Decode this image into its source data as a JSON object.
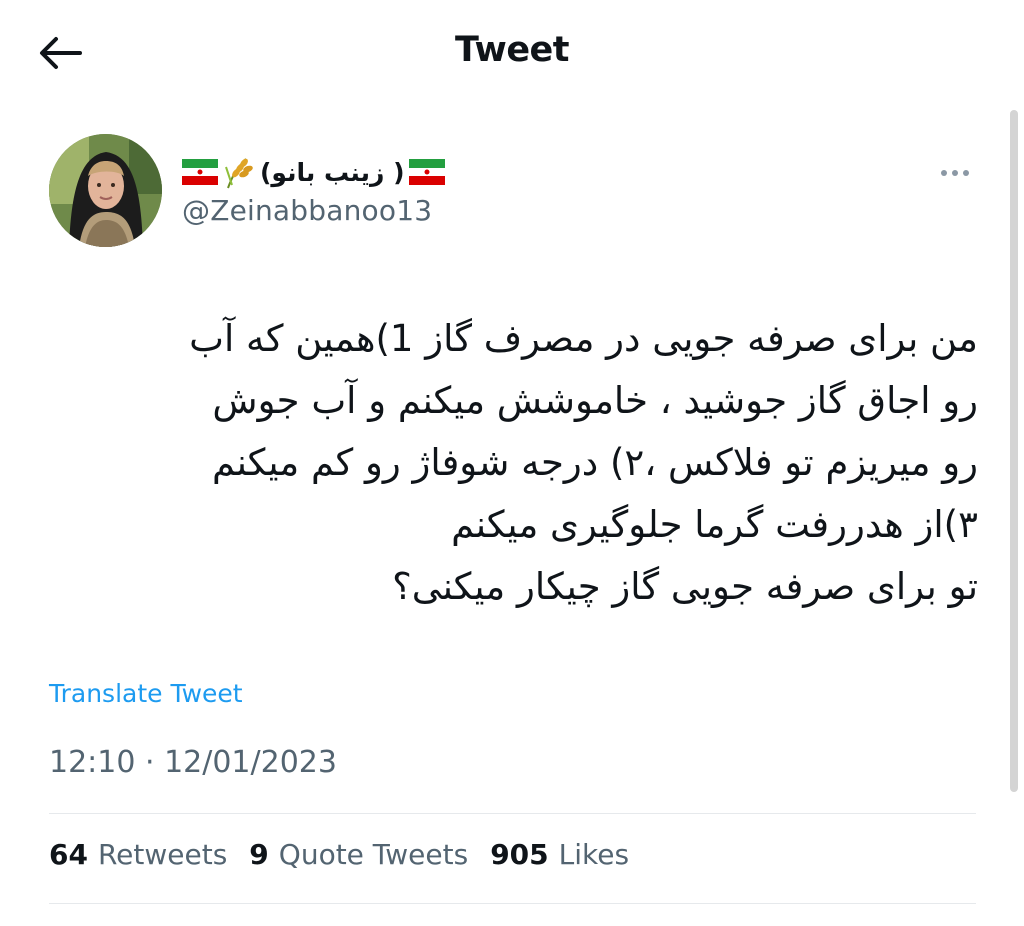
{
  "header": {
    "title": "Tweet",
    "back_icon": "arrow-left-icon"
  },
  "author": {
    "display_name": "( زینب بانو)",
    "handle": "@Zeinabbanoo13",
    "icons": [
      "iran-flag-icon",
      "wheat-icon",
      "iran-flag-icon"
    ]
  },
  "tweet": {
    "lines": [
      "من برای صرفه جویی در مصرف گاز 1)همین که آب",
      "رو اجاق گاز جوشید ، خاموشش میکنم و آب جوش",
      "رو میریزم تو فلاکس ،۲) درجه شوفاژ رو کم میکنم",
      "۳)از هدررفت گرما جلوگیری میکنم",
      "تو برای صرفه جویی گاز چیکار میکنی؟"
    ],
    "translate_label": "Translate Tweet",
    "timestamp": "12:10 · 12/01/2023"
  },
  "stats": [
    {
      "count": "64",
      "label": "Retweets"
    },
    {
      "count": "9",
      "label": "Quote Tweets"
    },
    {
      "count": "905",
      "label": "Likes"
    }
  ],
  "colors": {
    "link": "#1d9bf0",
    "secondary_text": "#536471",
    "primary_text": "#0f1419",
    "divider": "#e6e9ec"
  }
}
